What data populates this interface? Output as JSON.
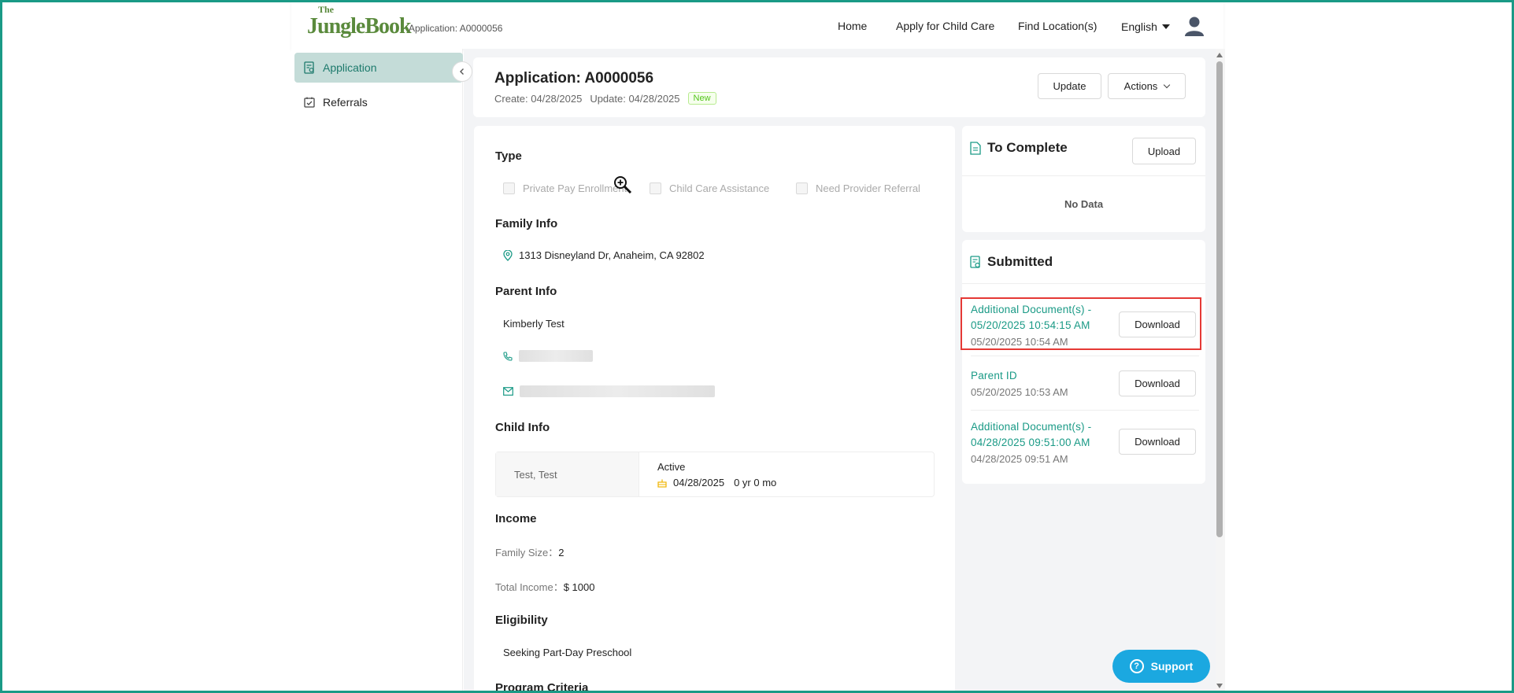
{
  "header": {
    "logo_the": "The",
    "logo_main": "JungleBook",
    "app_label": "Application: A0000056",
    "nav": {
      "home": "Home",
      "apply": "Apply for Child Care",
      "find": "Find Location(s)"
    },
    "language": "English"
  },
  "sidebar": {
    "items": [
      {
        "label": "Application",
        "icon": "application-icon",
        "active": true
      },
      {
        "label": "Referrals",
        "icon": "referrals-icon",
        "active": false
      }
    ]
  },
  "application": {
    "title": "Application: A0000056",
    "create_label": "Create: 04/28/2025",
    "update_label": "Update: 04/28/2025",
    "status_tag": "New",
    "update_button": "Update",
    "actions_button": "Actions"
  },
  "details": {
    "type": {
      "title": "Type",
      "options": [
        "Private Pay Enrollment",
        "Child Care Assistance",
        "Need Provider Referral"
      ]
    },
    "family": {
      "title": "Family Info",
      "address": "1313 Disneyland Dr, Anaheim, CA 92802"
    },
    "parent": {
      "title": "Parent Info",
      "name": "Kimberly Test"
    },
    "child": {
      "title": "Child Info",
      "name": "Test, Test",
      "status": "Active",
      "dob": "04/28/2025",
      "age": "0 yr 0 mo"
    },
    "income": {
      "title": "Income",
      "family_size_label": "Family Size：",
      "family_size": "2",
      "total_income_label": "Total Income：",
      "total_income": "$ 1000"
    },
    "eligibility": {
      "title": "Eligibility",
      "value": "Seeking Part-Day Preschool"
    },
    "program_criteria": {
      "title": "Program Criteria"
    }
  },
  "to_complete": {
    "title": "To Complete",
    "upload_button": "Upload",
    "empty_text": "No Data"
  },
  "submitted": {
    "title": "Submitted",
    "download_label": "Download",
    "docs": [
      {
        "title": "Additional Document(s) - 05/20/2025 10:54:15 AM",
        "date": "05/20/2025 10:54 AM"
      },
      {
        "title": "Parent ID",
        "date": "05/20/2025 10:53 AM"
      },
      {
        "title": "Additional Document(s) - 04/28/2025 09:51:00 AM",
        "date": "04/28/2025 09:51 AM"
      }
    ]
  },
  "support": {
    "label": "Support"
  },
  "colors": {
    "accent": "#1a9a86",
    "highlight": "#e53935",
    "support": "#1ba8e0",
    "logo": "#5a8a3c"
  }
}
